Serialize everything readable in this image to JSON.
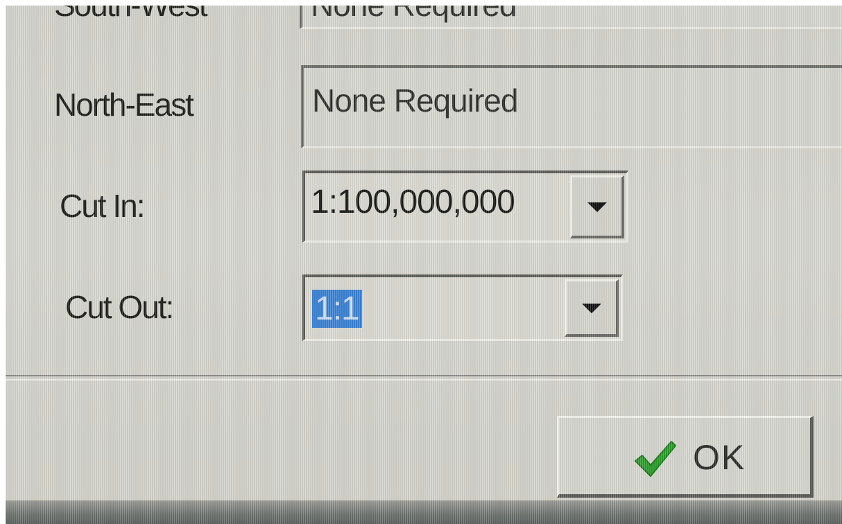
{
  "dialog": {
    "rows": [
      {
        "label": "South-West",
        "value": "None Required"
      },
      {
        "label": "North-East",
        "value": "None Required"
      }
    ],
    "cut_in": {
      "label": "Cut In:",
      "value": "1:100,000,000"
    },
    "cut_out": {
      "label": "Cut Out:",
      "value": "1:1"
    }
  },
  "ok_button": {
    "label": "OK",
    "icon": "check-icon"
  },
  "colors": {
    "selection": "#3b83d6",
    "check": "#2aa02a"
  }
}
